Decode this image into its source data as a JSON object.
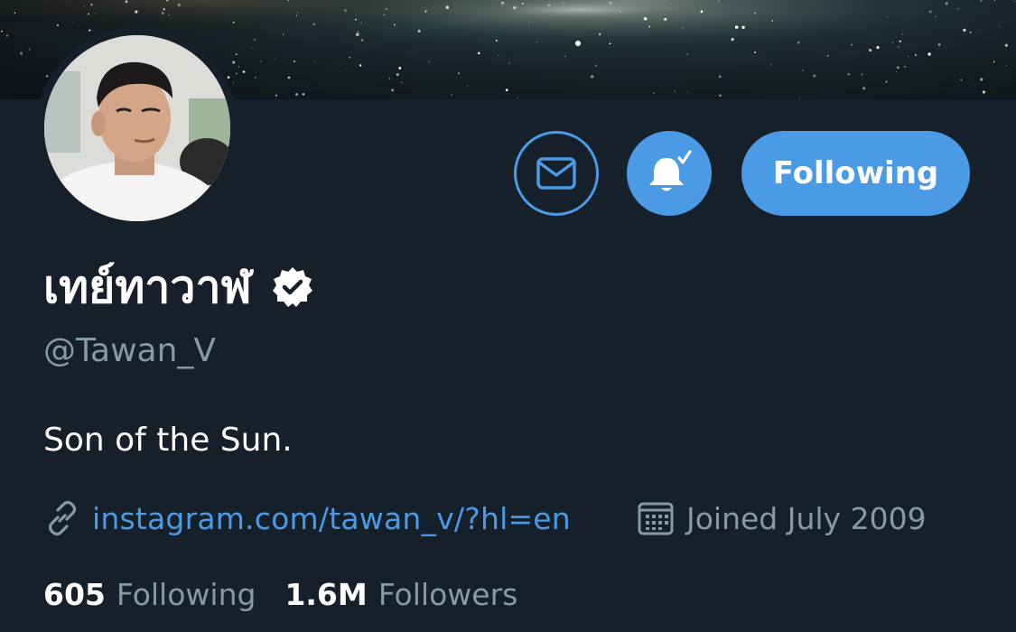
{
  "profile": {
    "display_name": "เทย์ทาวาฬ",
    "handle": "@Tawan_V",
    "bio": "Son of the Sun.",
    "website": "instagram.com/tawan_v/?hl=en",
    "joined": "Joined July 2009",
    "verified": true
  },
  "actions": {
    "message_icon": "envelope-icon",
    "notify_icon": "bell-check-icon",
    "follow_label": "Following"
  },
  "stats": {
    "following_count": "605",
    "following_label": "Following",
    "followers_count": "1.6M",
    "followers_label": "Followers"
  },
  "colors": {
    "background": "#15202b",
    "accent": "#4a9ae6",
    "muted_text": "#8899a6",
    "primary_text": "#ffffff"
  }
}
